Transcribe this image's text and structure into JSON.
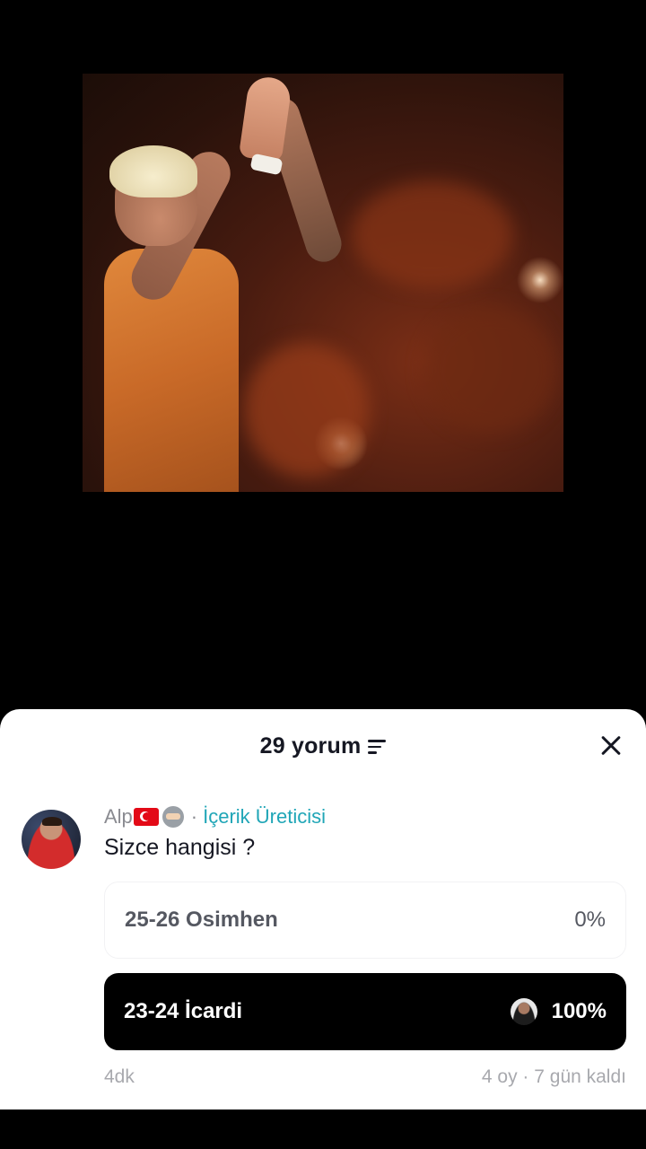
{
  "header": {
    "comment_count": "29 yorum"
  },
  "comment": {
    "author": "Alp",
    "badges": [
      "turkey-flag",
      "ninja-emoji"
    ],
    "separator": "·",
    "creator_label": "İçerik Üreticisi",
    "text": "Sizce hangisi ?",
    "time": "4dk"
  },
  "poll": {
    "options": [
      {
        "label": "25-26 Osimhen",
        "percent": "0%",
        "selected": false
      },
      {
        "label": "23-24 İcardi",
        "percent": "100%",
        "selected": true
      }
    ],
    "meta": "4 oy · 7 gün kaldı"
  },
  "colors": {
    "creator_accent": "#20a6b7",
    "selected_option_bg": "#000000",
    "sheet_bg": "#ffffff"
  }
}
